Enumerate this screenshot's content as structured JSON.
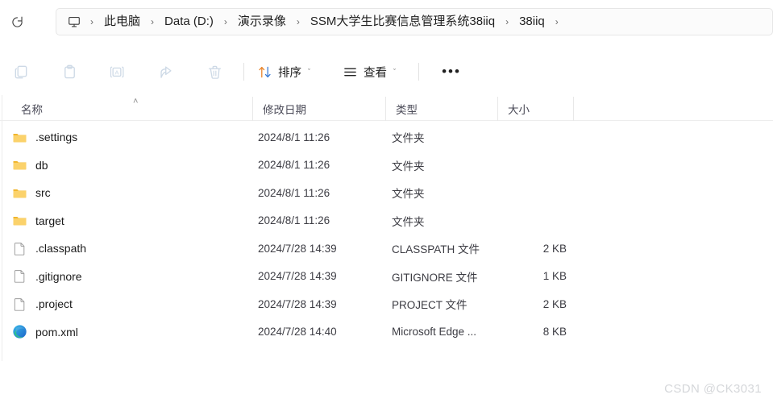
{
  "addressbar": {
    "refresh_icon": "refresh-icon",
    "pc_icon": "this-pc-icon",
    "separator": "›",
    "crumbs": [
      {
        "label": "此电脑"
      },
      {
        "label": "Data (D:)"
      },
      {
        "label": "演示录像"
      },
      {
        "label": "SSM大学生比赛信息管理系统38iiq"
      },
      {
        "label": "38iiq"
      }
    ]
  },
  "toolbar": {
    "icon_buttons": [
      {
        "name": "copy-icon",
        "disabled": true
      },
      {
        "name": "paste-icon",
        "disabled": true
      },
      {
        "name": "rename-icon",
        "disabled": true
      },
      {
        "name": "share-icon",
        "disabled": true
      },
      {
        "name": "delete-icon",
        "disabled": true
      }
    ],
    "sort_label": "排序",
    "sort_icon": "sort-arrows-icon",
    "view_label": "查看",
    "view_icon": "view-lines-icon",
    "chevron": "ˇ",
    "more_label": "•••"
  },
  "columns": {
    "name": "名称",
    "date": "修改日期",
    "type": "类型",
    "size": "大小",
    "sort_indicator": "˄"
  },
  "files": [
    {
      "name": ".settings",
      "date": "2024/8/1 11:26",
      "type": "文件夹",
      "size": "",
      "icon": "folder-icon"
    },
    {
      "name": "db",
      "date": "2024/8/1 11:26",
      "type": "文件夹",
      "size": "",
      "icon": "folder-icon"
    },
    {
      "name": "src",
      "date": "2024/8/1 11:26",
      "type": "文件夹",
      "size": "",
      "icon": "folder-icon"
    },
    {
      "name": "target",
      "date": "2024/8/1 11:26",
      "type": "文件夹",
      "size": "",
      "icon": "folder-icon"
    },
    {
      "name": ".classpath",
      "date": "2024/7/28 14:39",
      "type": "CLASSPATH 文件",
      "size": "2 KB",
      "icon": "generic-file-icon"
    },
    {
      "name": ".gitignore",
      "date": "2024/7/28 14:39",
      "type": "GITIGNORE 文件",
      "size": "1 KB",
      "icon": "generic-file-icon"
    },
    {
      "name": ".project",
      "date": "2024/7/28 14:39",
      "type": "PROJECT 文件",
      "size": "2 KB",
      "icon": "generic-file-icon"
    },
    {
      "name": "pom.xml",
      "date": "2024/7/28 14:40",
      "type": "Microsoft Edge ...",
      "size": "8 KB",
      "icon": "edge-icon"
    }
  ],
  "watermark": "CSDN @CK3031",
  "colors": {
    "folder": "#F6C453",
    "accent_blue": "#0078d4",
    "sort_up": "#E8842A",
    "sort_down": "#3A7BD5",
    "disabled_icon": "#cdd9e6"
  }
}
